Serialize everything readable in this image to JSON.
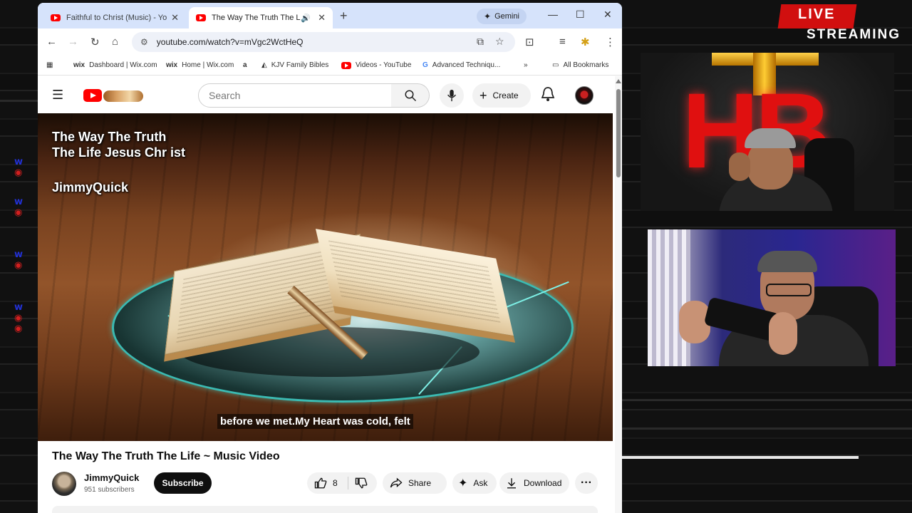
{
  "browser": {
    "tabs": [
      {
        "title": "Faithful to Christ (Music) - YouT",
        "active": false
      },
      {
        "title": "The Way The Truth The Life",
        "active": true
      }
    ],
    "gemini_label": "Gemini",
    "url": "youtube.com/watch?v=mVgc2WctHeQ",
    "bookmarks": [
      {
        "icon": "wix",
        "label": "Dashboard | Wix.com"
      },
      {
        "icon": "wix",
        "label": "Home | Wix.com"
      },
      {
        "icon": "a",
        "label": ""
      },
      {
        "icon": "kjv",
        "label": "KJV Family Bibles"
      },
      {
        "icon": "yt",
        "label": "Videos - YouTube"
      },
      {
        "icon": "G",
        "label": "Advanced Techniqu..."
      }
    ],
    "all_bookmarks": "All Bookmarks"
  },
  "youtube": {
    "search_placeholder": "Search",
    "create_label": "Create",
    "video": {
      "overlay_title": "The Way The Truth The Life Jesus Chr ist",
      "overlay_author": "JimmyQuick",
      "caption": "before we met.My Heart was cold, felt"
    },
    "title": "The Way The Truth The Life ~ Music Video",
    "channel": {
      "name": "JimmyQuick",
      "subscribers": "951 subscribers"
    },
    "subscribe_label": "Subscribe",
    "like_count": "8",
    "share_label": "Share",
    "ask_label": "Ask",
    "download_label": "Download"
  },
  "stream": {
    "live_label": "LIVE",
    "streaming_label": "STREAMING",
    "cam1_sign": "HB"
  },
  "icons": {
    "back": "arrow-left-icon",
    "forward": "arrow-right-icon",
    "reload": "reload-icon",
    "home": "home-icon",
    "menu": "hamburger-icon",
    "search": "search-icon",
    "mic": "microphone-icon",
    "bell": "bell-icon",
    "like": "thumbs-up-icon",
    "dislike": "thumbs-down-icon",
    "share": "share-icon",
    "ask": "sparkle-icon",
    "download": "download-icon",
    "more": "more-horizontal-icon"
  },
  "colors": {
    "youtube_red": "#ff0000",
    "tabstrip": "#d6e3fb",
    "live_red": "#d10f0f"
  }
}
